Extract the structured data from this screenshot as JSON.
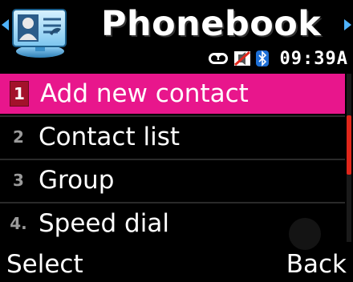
{
  "header": {
    "title": "Phonebook",
    "clock": "09:39A",
    "icons": [
      "voicemail-icon",
      "silent-mode-icon",
      "bluetooth-icon"
    ]
  },
  "menu": {
    "items": [
      {
        "number": "1",
        "label": "Add new contact",
        "selected": true
      },
      {
        "number": "2",
        "label": "Contact list",
        "selected": false
      },
      {
        "number": "3",
        "label": "Group",
        "selected": false
      },
      {
        "number": "4.",
        "label": "Speed dial",
        "selected": false
      }
    ]
  },
  "softkeys": {
    "left": "Select",
    "right": "Back"
  },
  "colors": {
    "highlight": "#e8168c",
    "number_badge": "#a3122b",
    "scrollbar": "#e0261a",
    "nav_arrow": "#4fb3ff"
  }
}
